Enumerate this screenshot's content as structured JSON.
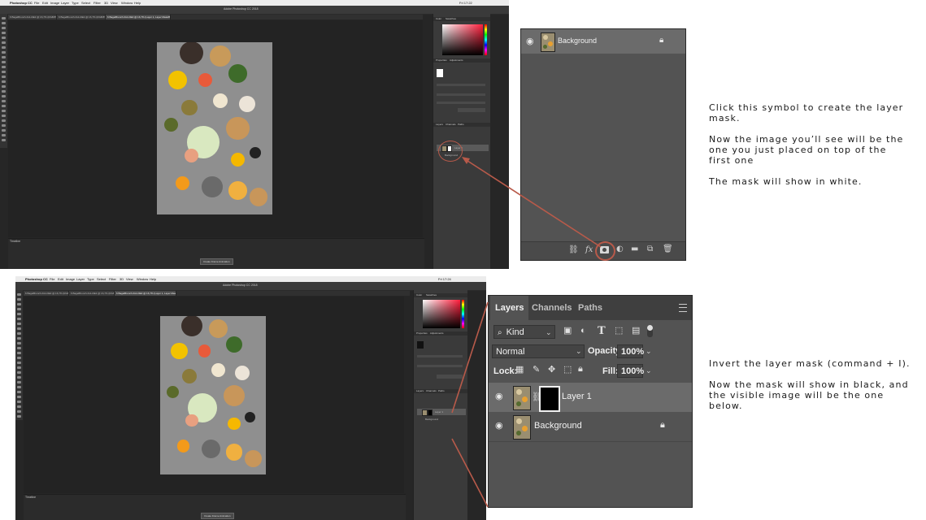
{
  "screenshot_top": {
    "menu": [
      "Photoshop CC",
      "File",
      "Edit",
      "Image",
      "Layer",
      "Type",
      "Select",
      "Filter",
      "3D",
      "View",
      "Window",
      "Help"
    ],
    "app_title": "Adobe Photoshop CC 2018",
    "status_right": "Fri 17:22",
    "tabs": [
      "6 BagelBrunch-IG1-DE2 @ 16,7% (RGB/8*)",
      "6 BagelBrunch-IG1-DE2 @ 16,7% (RGB/8*)",
      "6 BagelBrunch-IG1-DE2 @ 16,7% (Layer 1, Layer Mask/8)"
    ],
    "timeline_title": "Timeline",
    "create_anim_button": "Create Frame Animation",
    "panel_tabs_top": [
      "Color",
      "Swatches"
    ],
    "panel_tabs_mid": [
      "Properties",
      "Adjustments"
    ],
    "panel_tabs_layers": [
      "Layers",
      "Channels",
      "Paths"
    ],
    "mini_layers": [
      "Layer 1",
      "Background"
    ]
  },
  "screenshot_bottom": {
    "menu": [
      "Photoshop CC",
      "File",
      "Edit",
      "Image",
      "Layer",
      "Type",
      "Select",
      "Filter",
      "3D",
      "View",
      "Window",
      "Help"
    ],
    "app_title": "Adobe Photoshop CC 2018",
    "status_right": "Fri 17:24",
    "tabs": [
      "6 BagelBrunch-IG1-DE2 @ 16,7% (RGB/8*)",
      "6 BagelBrunch-IG1-DE2 @ 16,7% (RGB/8*)",
      "6 BagelBrunch-IG1-DE2 @ 16,7% (Layer 1, Layer Mask/8)"
    ],
    "timeline_title": "Timeline",
    "create_anim_button": "Create Frame Animation",
    "panel_tabs_top": [
      "Color",
      "Swatches"
    ],
    "panel_tabs_mid": [
      "Properties",
      "Adjustments"
    ],
    "panel_tabs_layers": [
      "Layers",
      "Channels",
      "Paths"
    ],
    "mini_layers": [
      "Layer 1",
      "Background"
    ]
  },
  "zoom_top": {
    "layer_name": "Background",
    "bottom_icons": [
      "link-icon",
      "fx-icon",
      "add-mask-icon",
      "adjustment-icon",
      "folder-icon",
      "new-layer-icon",
      "trash-icon"
    ],
    "fx_label": "fx"
  },
  "zoom_bottom": {
    "tabs": [
      "Layers",
      "Channels",
      "Paths"
    ],
    "kind_label": "Kind",
    "blend_mode": "Normal",
    "opacity_label": "Opacity:",
    "opacity_value": "100%",
    "lock_label": "Lock:",
    "fill_label": "Fill:",
    "fill_value": "100%",
    "layers": [
      {
        "name": "Layer 1",
        "has_mask": true,
        "selected": true
      },
      {
        "name": "Background",
        "has_mask": false,
        "selected": false,
        "locked": true
      }
    ]
  },
  "notes": {
    "top": "Click this symbol to create the layer mask.\n\nNow the image you’ll see will be the one you just placed on top of the first one\n\nThe mask will show in white.",
    "bottom": "Invert the layer mask (command + I).\n\nNow the mask will show in black, and the visible image will be the one below."
  },
  "colors": {
    "annotation": "#b85a4a",
    "ps_bg": "#262626",
    "panel": "#535353"
  }
}
